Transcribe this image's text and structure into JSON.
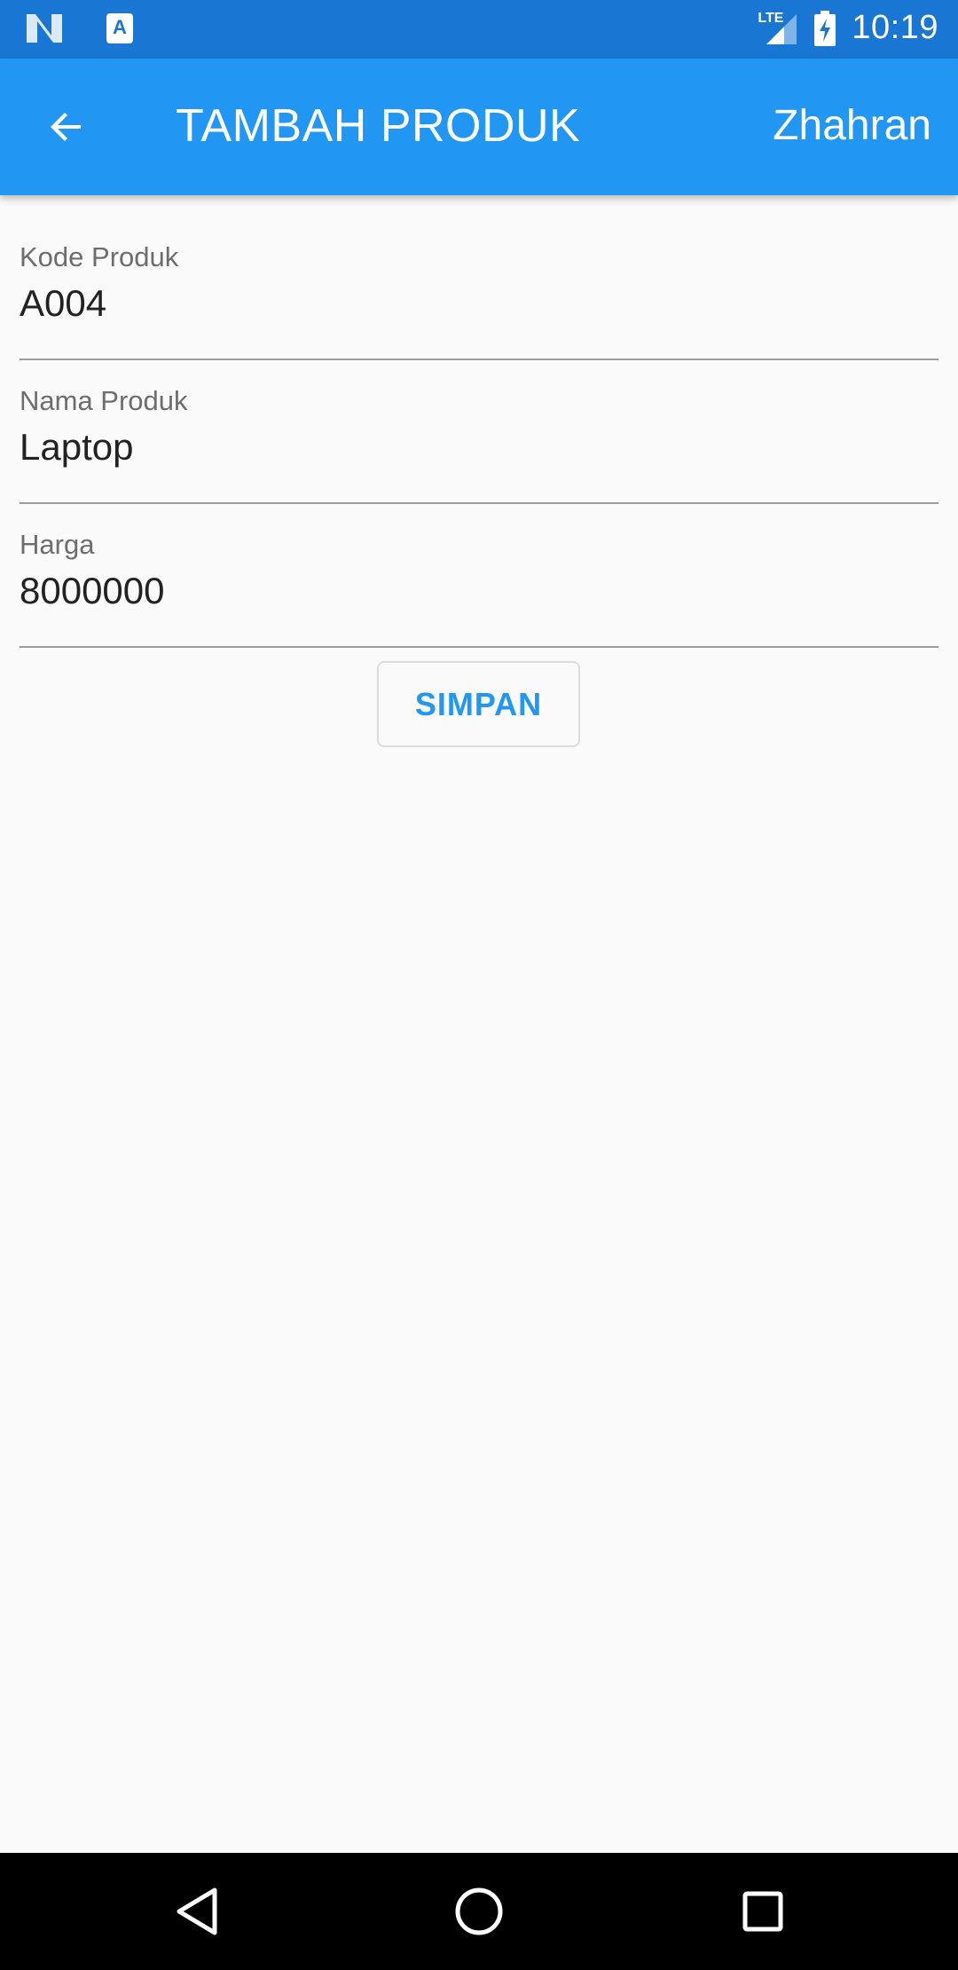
{
  "status_bar": {
    "time": "10:19",
    "network": "LTE",
    "notification_icons": [
      "n-logo-icon",
      "text-a-icon"
    ],
    "color": "#1976d2"
  },
  "app_bar": {
    "title": "TAMBAH PRODUK",
    "user": "Zhahran",
    "color": "#2196f3"
  },
  "form": {
    "fields": [
      {
        "label": "Kode Produk",
        "value": "A004"
      },
      {
        "label": "Nama Produk",
        "value": "Laptop"
      },
      {
        "label": "Harga",
        "value": "8000000"
      }
    ],
    "save_label": "SIMPAN"
  },
  "nav_bar": {
    "icons": [
      "back-triangle-icon",
      "home-circle-icon",
      "recents-square-icon"
    ]
  }
}
